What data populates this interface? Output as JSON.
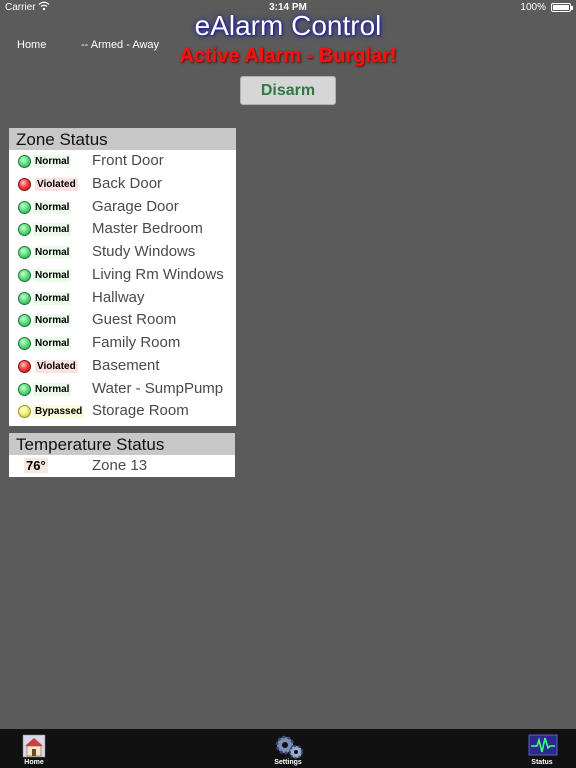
{
  "status_bar": {
    "carrier": "Carrier",
    "time": "3:14 PM",
    "battery": "100%"
  },
  "header": {
    "home_label": "Home",
    "mode": "-- Armed - Away",
    "title": "eAlarm Control",
    "alarm_status": "Active Alarm - Burglar!",
    "disarm_label": "Disarm"
  },
  "zone_status": {
    "title": "Zone Status",
    "zones": [
      {
        "state": "Normal",
        "name": "Front Door",
        "color": "#3fcf6a"
      },
      {
        "state": "Violated",
        "name": "Back Door",
        "color": "#e03030"
      },
      {
        "state": "Normal",
        "name": "Garage Door",
        "color": "#3fcf6a"
      },
      {
        "state": "Normal",
        "name": "Master Bedroom",
        "color": "#3fcf6a"
      },
      {
        "state": "Normal",
        "name": "Study Windows",
        "color": "#3fcf6a"
      },
      {
        "state": "Normal",
        "name": "Living Rm Windows",
        "color": "#3fcf6a"
      },
      {
        "state": "Normal",
        "name": "Hallway",
        "color": "#3fcf6a"
      },
      {
        "state": "Normal",
        "name": "Guest Room",
        "color": "#3fcf6a"
      },
      {
        "state": "Normal",
        "name": "Family Room",
        "color": "#3fcf6a"
      },
      {
        "state": "Violated",
        "name": "Basement",
        "color": "#e03030"
      },
      {
        "state": "Normal",
        "name": "Water - SumpPump",
        "color": "#3fcf6a"
      },
      {
        "state": "Bypassed",
        "name": "Storage Room",
        "color": "#e6e25a"
      }
    ]
  },
  "temperature_status": {
    "title": "Temperature Status",
    "readings": [
      {
        "value": "76°",
        "zone": "Zone 13"
      }
    ]
  },
  "tabs": [
    {
      "label": "Home",
      "icon": "house-icon"
    },
    {
      "label": "Settings",
      "icon": "gears-icon"
    },
    {
      "label": "Status",
      "icon": "pulse-monitor-icon"
    }
  ]
}
